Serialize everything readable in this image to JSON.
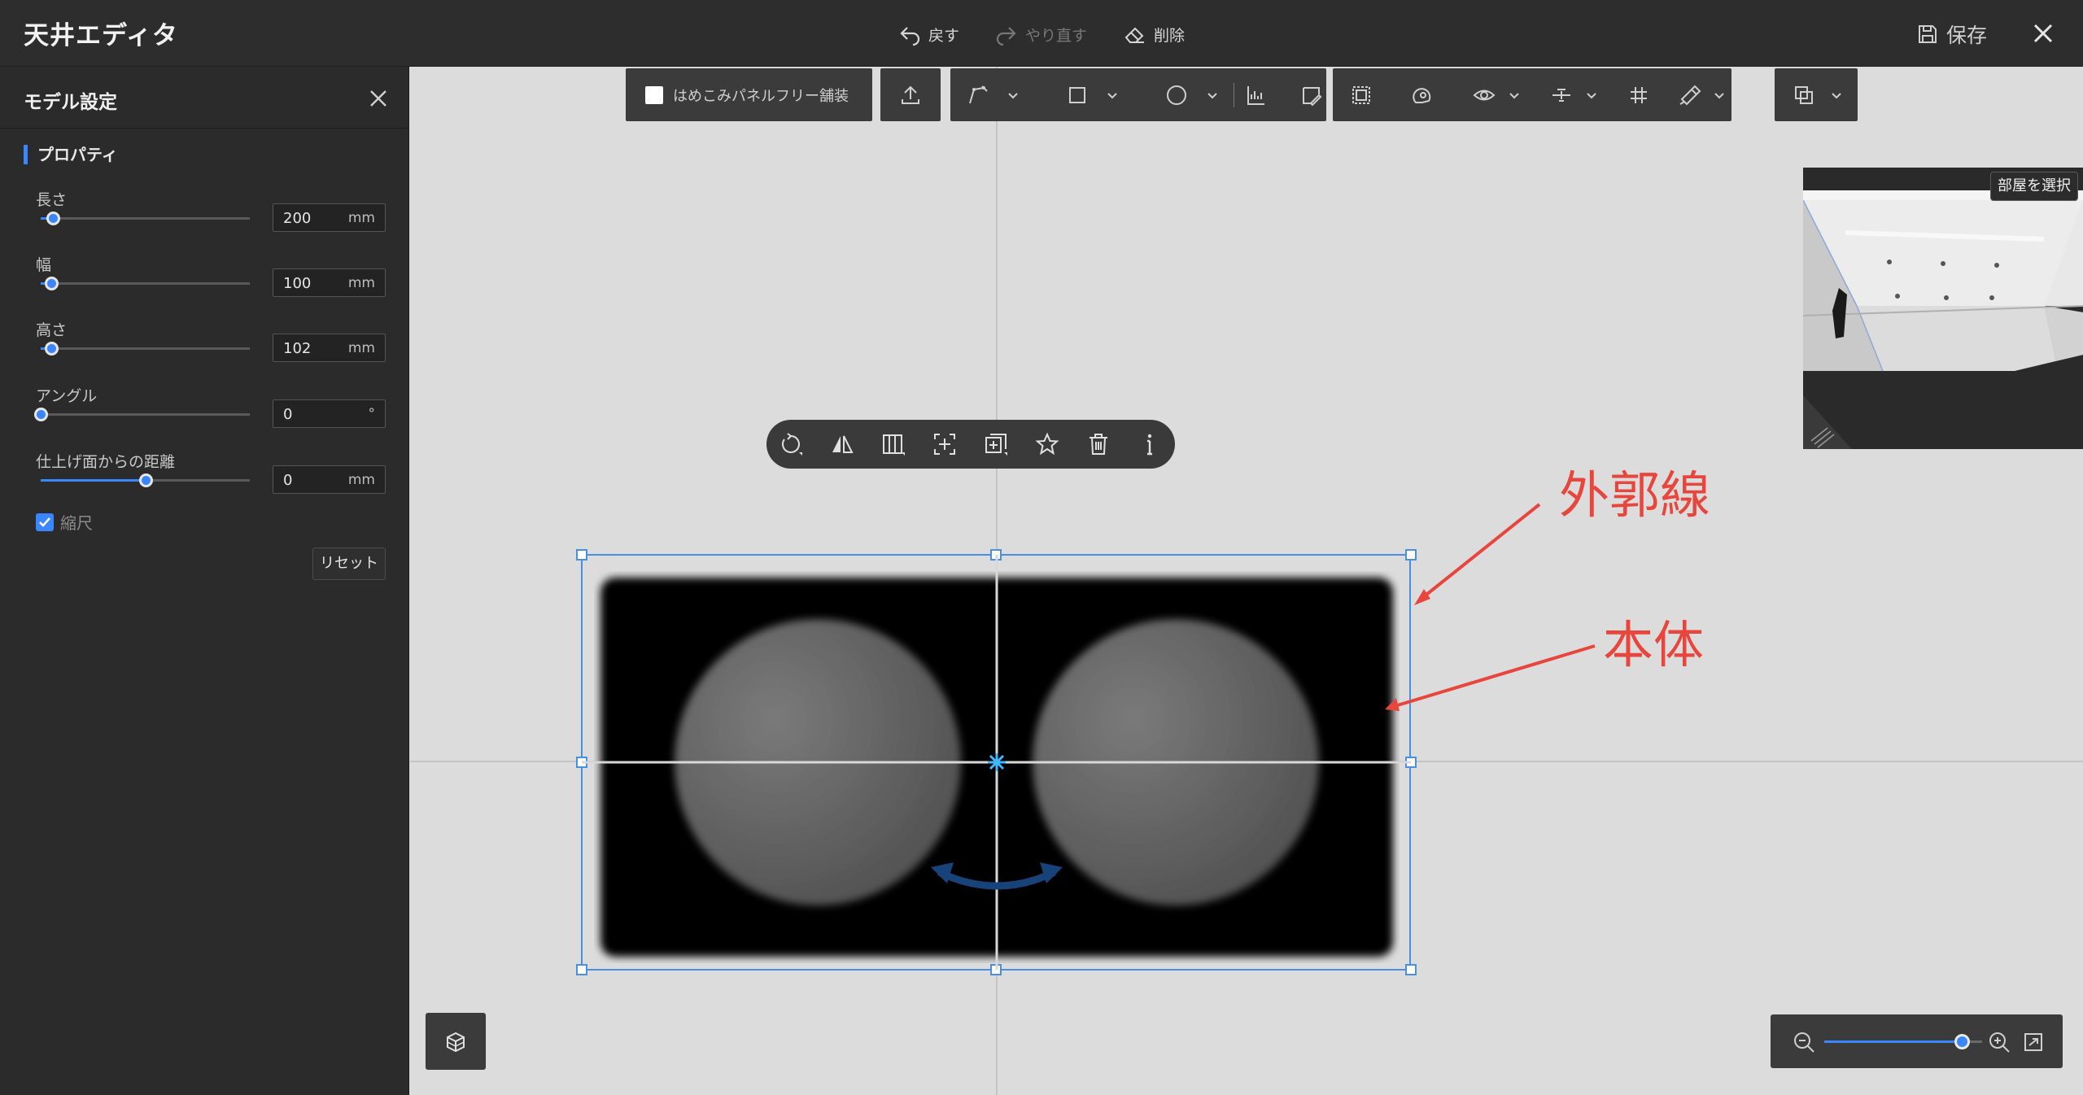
{
  "app": {
    "title": "天井エディタ",
    "actions": {
      "undo": "戻す",
      "redo": "やり直す",
      "delete": "削除",
      "save": "保存"
    }
  },
  "panel": {
    "title": "モデル設定",
    "section": "プロパティ",
    "properties": [
      {
        "label": "長さ",
        "value": "200",
        "unit": "mm",
        "slider_fraction": 0.06
      },
      {
        "label": "幅",
        "value": "100",
        "unit": "mm",
        "slider_fraction": 0.05
      },
      {
        "label": "高さ",
        "value": "102",
        "unit": "mm",
        "slider_fraction": 0.05
      },
      {
        "label": "アングル",
        "value": "0",
        "unit": "°",
        "slider_fraction": 0.0
      },
      {
        "label": "仕上げ面からの距離",
        "value": "0",
        "unit": "mm",
        "slider_fraction": 0.5
      }
    ],
    "scale_label": "縮尺",
    "scale_checked": true,
    "reset_label": "リセット"
  },
  "toolbar": {
    "paving_label": "はめこみパネルフリー舗装"
  },
  "minimap": {
    "room_button": "部屋を選択"
  },
  "annotations": {
    "outline": "外郭線",
    "body": "本体"
  },
  "zoom": {
    "level_fraction": 0.86
  },
  "colors": {
    "accent": "#3a86ff",
    "selection": "#4a90e2",
    "annotation": "#e8453c",
    "dark_bg": "#2b2b2b"
  }
}
